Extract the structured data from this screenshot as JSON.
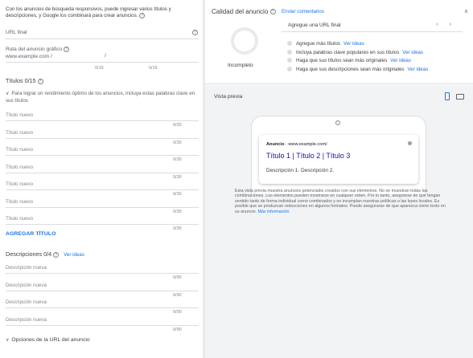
{
  "form": {
    "intro": "Con los anuncios de búsqueda responsivos, puede ingresar varios títulos y descripciones, y Google los combinará para crear anuncios.",
    "final_url_label": "URL final",
    "display_path_label": "Ruta del anuncio gráfico",
    "display_path_domain": "www.example.com",
    "display_path_separator": "/",
    "path1_counter": "0/15",
    "path2_counter": "0/15",
    "headlines_title": "Títulos 0/15",
    "headlines_tip": "Para lograr un rendimiento óptimo de los anuncios, incluya estas palabras clave en sus títulos",
    "headline_placeholder": "Título nuevo",
    "headline_counter": "0/30",
    "headlines": [
      {
        "placeholder": "Título nuevo",
        "counter": "0/30"
      },
      {
        "placeholder": "Título nuevo",
        "counter": "0/30"
      },
      {
        "placeholder": "Título nuevo",
        "counter": "0/30"
      },
      {
        "placeholder": "Título nuevo",
        "counter": "0/30"
      },
      {
        "placeholder": "Título nuevo",
        "counter": "0/30"
      },
      {
        "placeholder": "Título nuevo",
        "counter": "0/30"
      },
      {
        "placeholder": "Título nuevo",
        "counter": "0/30"
      }
    ],
    "add_headline": "AGREGAR TÍTULO",
    "descriptions_title": "Descripciones 0/4",
    "descriptions_ideas": "Ver ideas",
    "descriptions": [
      {
        "placeholder": "Descripción nueva",
        "counter": "0/90"
      },
      {
        "placeholder": "Descripción nueva",
        "counter": "0/90"
      },
      {
        "placeholder": "Descripción nueva",
        "counter": "0/90"
      },
      {
        "placeholder": "Descripción nueva",
        "counter": "0/90"
      }
    ],
    "url_options": "Opciones de la URL del anuncio"
  },
  "quality": {
    "title": "Calidad del anuncio",
    "send_feedback": "Enviar comentarios",
    "status": "Incompleto",
    "current_suggestion": "Agregue una URL final",
    "nav": "‹ ›",
    "suggestions": [
      {
        "text": "Agregue más títulos",
        "link": "Ver ideas"
      },
      {
        "text": "Incluya palabras clave populares en sus títulos",
        "link": "Ver ideas"
      },
      {
        "text": "Haga que sus títulos sean más originales",
        "link": "Ver ideas"
      },
      {
        "text": "Haga que sus descripciones sean más originales",
        "link": "Ver ideas"
      }
    ]
  },
  "preview": {
    "title": "Vista previa",
    "ad_label": "Anuncio",
    "ad_separator": " · ",
    "ad_url": "www.example.com/",
    "ad_headline": "Título 1 | Título 2 | Título 3",
    "ad_description": "Descripción 1. Descripción 2.",
    "disclaimer": "Esta vista previa muestra anuncios potenciales creados con sus elementos. No se muestran todas las combinaciones. Los elementos pueden mostrarse en cualquier orden. Por lo tanto, asegúrese de que tengan sentido tanto de forma individual como combinados y no incumplan nuestras políticas o las leyes locales. Es posible que se produzcan reducciones en algunos formatos. Puede asegurarse de que aparezca cierto texto en su anuncio.",
    "learn_more": "Más información"
  },
  "icons": {
    "help": "?",
    "chevron": "∨",
    "collapse": "∧"
  }
}
